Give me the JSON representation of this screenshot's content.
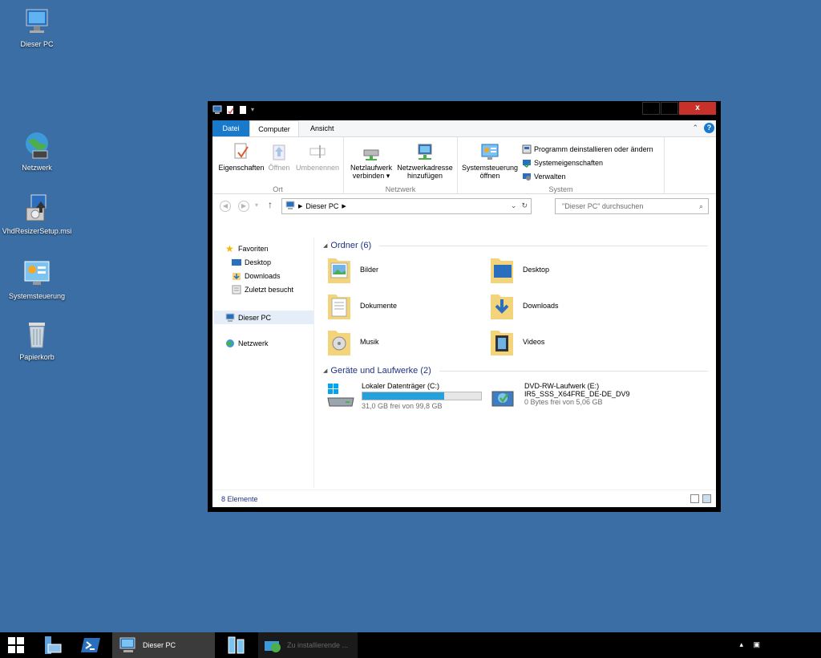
{
  "desktop": {
    "icons": [
      {
        "label": "Dieser PC",
        "icon": "computer-icon"
      },
      {
        "label": "Netzwerk",
        "icon": "network-globe-icon"
      },
      {
        "label": "VhdResizerSetup.msi",
        "icon": "installer-icon"
      },
      {
        "label": "Systemsteuerung",
        "icon": "control-panel-icon"
      },
      {
        "label": "Papierkorb",
        "icon": "recycle-bin-icon"
      }
    ]
  },
  "window": {
    "close_glyph": "x",
    "tabs": {
      "file": "Datei",
      "computer": "Computer",
      "view": "Ansicht"
    },
    "ribbon": {
      "groups": {
        "ort": "Ort",
        "netzwerk": "Netzwerk",
        "system": "System"
      },
      "properties": "Eigenschaften",
      "open": "Öffnen",
      "rename": "Umbenennen",
      "map_drive_1": "Netzlaufwerk",
      "map_drive_2": "verbinden ▾",
      "add_location_1": "Netzwerkadresse",
      "add_location_2": "hinzufügen",
      "control_panel_1": "Systemsteuerung",
      "control_panel_2": "öffnen",
      "uninstall": "Programm deinstallieren oder ändern",
      "sys_props": "Systemeigenschaften",
      "manage": "Verwalten"
    },
    "address": {
      "path": "Dieser PC"
    },
    "search": {
      "placeholder": "\"Dieser PC\" durchsuchen"
    },
    "nav": {
      "favorites": "Favoriten",
      "desktop": "Desktop",
      "downloads": "Downloads",
      "recent": "Zuletzt besucht",
      "this_pc": "Dieser PC",
      "network": "Netzwerk"
    },
    "content": {
      "folders_header": "Ordner (6)",
      "folders": [
        "Bilder",
        "Desktop",
        "Dokumente",
        "Downloads",
        "Musik",
        "Videos"
      ],
      "devices_header": "Geräte und Laufwerke (2)",
      "drive_c": {
        "name": "Lokaler Datenträger (C:)",
        "free": "31,0 GB frei von 99,8 GB",
        "used_fraction": 0.69
      },
      "drive_e": {
        "name": "DVD-RW-Laufwerk (E:)",
        "label": "IR5_SSS_X64FRE_DE-DE_DV9",
        "free": "0 Bytes frei von 5,06 GB"
      }
    },
    "status": "8 Elemente"
  },
  "taskbar": {
    "explorer_label": "Dieser PC",
    "installer_label": "Zu installierende ..."
  }
}
